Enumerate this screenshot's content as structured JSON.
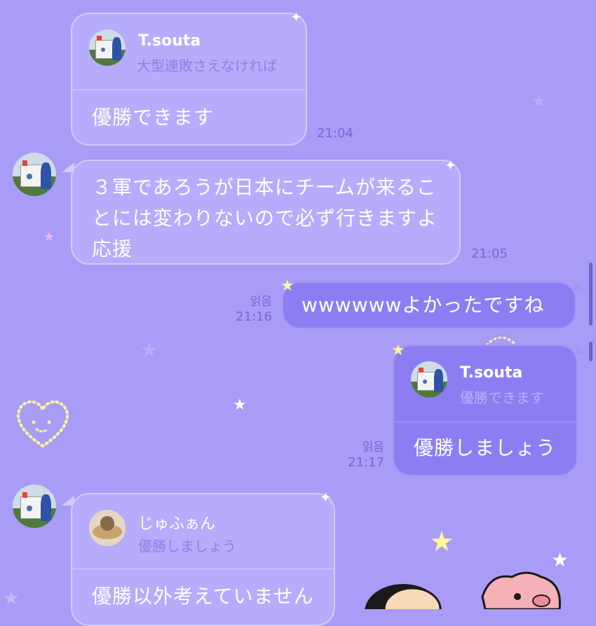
{
  "messages": {
    "m1": {
      "quote_name": "T.souta",
      "quote_text": "大型連敗さえなければ",
      "text": "優勝できます",
      "time": "21:04"
    },
    "m2": {
      "text": "３軍であろうが日本にチームが来ることには変わりないので必ず行きますよ応援",
      "time": "21:05"
    },
    "m3": {
      "text": "wwwwwwよかったですね",
      "read": "읽음",
      "time": "21:16"
    },
    "m4": {
      "quote_name": "T.souta",
      "quote_text": "優勝できます",
      "text": "優勝しましょう",
      "read": "읽음",
      "time": "21:17"
    },
    "m5": {
      "quote_name": "じゅふぁん",
      "quote_text": "優勝しましょう",
      "text": "優勝以外考えていません"
    }
  },
  "colors": {
    "background": "#a89cf6",
    "incoming_bubble": "#b7abfb",
    "outgoing_bubble": "#8c7ef2",
    "timestamp": "#7766d8"
  },
  "icons": [
    "avatar",
    "star-sticker-icon",
    "heart-sticker-icon",
    "character-sticker"
  ]
}
